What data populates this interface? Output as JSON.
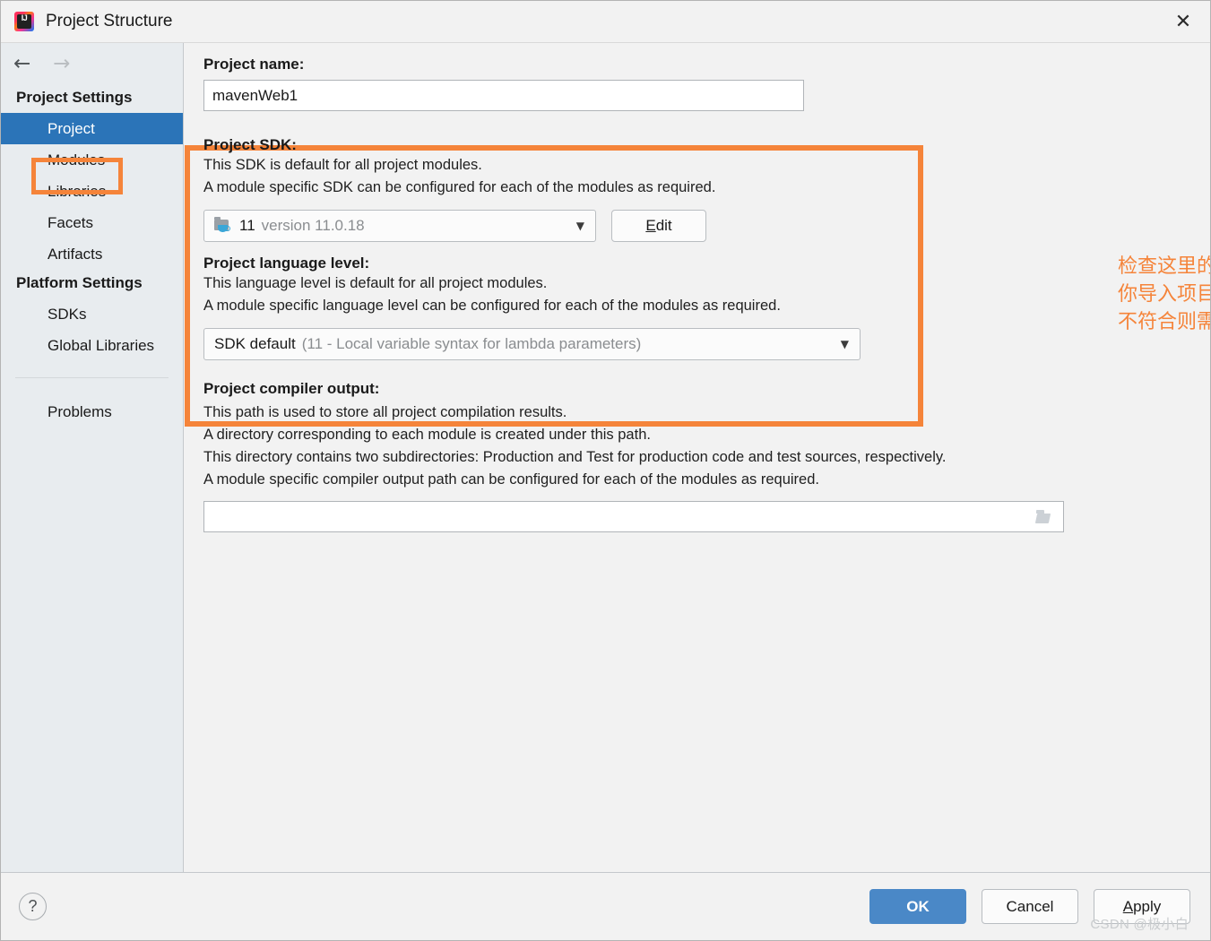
{
  "window": {
    "title": "Project Structure",
    "app_icon": "intellij-idea-icon",
    "close_label": "✕"
  },
  "sidebar": {
    "nav": {
      "back": "←",
      "forward": "→"
    },
    "groups": [
      {
        "header": "Project Settings",
        "items": [
          {
            "label": "Project",
            "selected": true,
            "highlighted": true
          },
          {
            "label": "Modules",
            "selected": false
          },
          {
            "label": "Libraries",
            "selected": false
          },
          {
            "label": "Facets",
            "selected": false
          },
          {
            "label": "Artifacts",
            "selected": false
          }
        ]
      },
      {
        "header": "Platform Settings",
        "items": [
          {
            "label": "SDKs",
            "selected": false
          },
          {
            "label": "Global Libraries",
            "selected": false
          }
        ]
      }
    ],
    "extra_items": [
      {
        "label": "Problems",
        "selected": false
      }
    ]
  },
  "main": {
    "project_name": {
      "label": "Project name:",
      "value": "mavenWeb1"
    },
    "project_sdk": {
      "label": "Project SDK:",
      "description_line1": "This SDK is default for all project modules.",
      "description_line2": "A module specific SDK can be configured for each of the modules as required.",
      "selected_name": "11",
      "selected_version": "version 11.0.18",
      "dropdown_caret": "▼",
      "icon": "java-sdk-folder-icon",
      "edit_button": {
        "mnemonic": "E",
        "rest": "dit"
      }
    },
    "project_language_level": {
      "label": "Project language level:",
      "description_line1": "This language level is default for all project modules.",
      "description_line2": "A module specific language level can be configured for each of the modules as required.",
      "selected_name": "SDK default",
      "selected_detail": "(11 - Local variable syntax for lambda parameters)",
      "dropdown_caret": "▼"
    },
    "project_compiler_output": {
      "label": "Project compiler output:",
      "description_line1": "This path is used to store all project compilation results.",
      "description_line2": "A directory corresponding to each module is created under this path.",
      "description_line3": "This directory contains two subdirectories: Production and Test for production code and test sources, respectively.",
      "description_line4": "A module specific compiler output path can be configured for each of the modules as required.",
      "value": "",
      "placeholder": "",
      "browse_icon": "open-folder-icon"
    }
  },
  "annotation": {
    "color": "#f5843a",
    "line1": "检查这里的jdk是否符合",
    "line2": "你导入项目的jdk版本，",
    "line3": "不符合则需要修改"
  },
  "footer": {
    "help_label": "?",
    "ok_label": "OK",
    "cancel_label": "Cancel",
    "apply": {
      "mnemonic": "A",
      "rest": "pply"
    },
    "watermark": "CSDN @极小白"
  },
  "colors": {
    "accent_orange": "#f5843a",
    "selection_blue": "#2b74b8",
    "primary_button_blue": "#4a88c7",
    "sidebar_bg": "#e8ecef",
    "panel_bg": "#f2f2f2"
  }
}
